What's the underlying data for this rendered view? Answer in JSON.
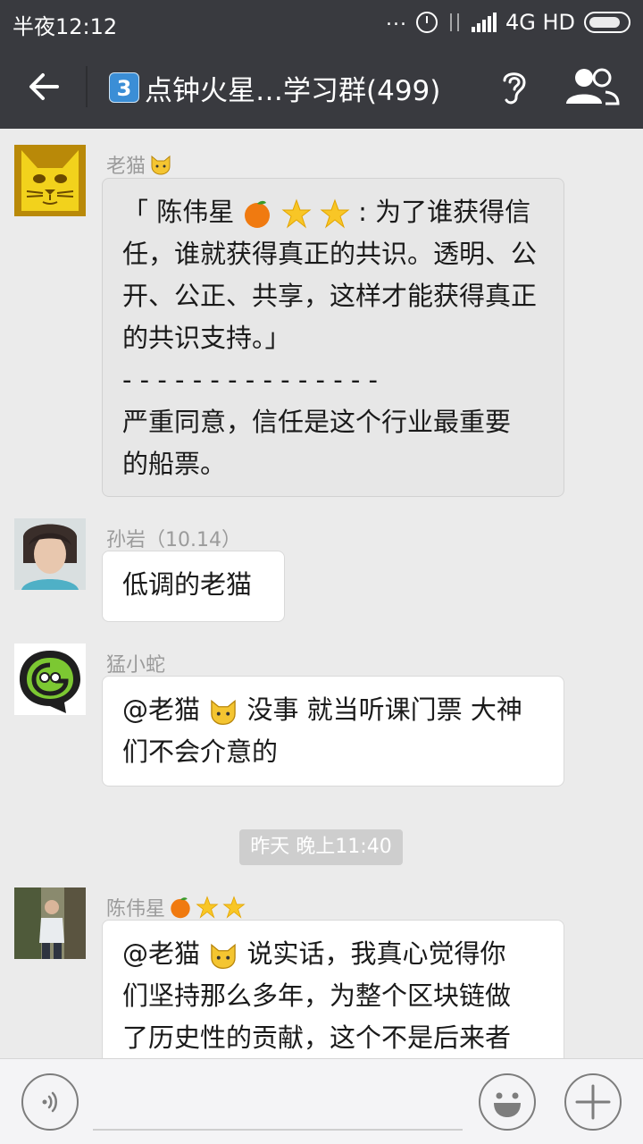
{
  "status_bar": {
    "time": "半夜12:12",
    "dots": "...",
    "network": "4G HD",
    "icons": [
      "alarm-icon",
      "data-transfer-icon",
      "signal-icon",
      "battery-icon"
    ]
  },
  "header": {
    "number_badge": "3",
    "title": "点钟火星…学习群(499)",
    "icons": [
      "back-arrow-icon",
      "ear-icon",
      "group-members-icon"
    ]
  },
  "messages": [
    {
      "sender": "老猫",
      "sender_emoji": "cat-face",
      "lines": [
        "「 陈伟星",
        "任，谁就获得真正的共识。透明、公",
        "开、公正、共享，这样才能获得真正",
        "的共识支持。」",
        "- - - - - - - - - - - - - - -",
        "严重同意，信任是这个行业最重要",
        "的船票。"
      ],
      "quote_tail": ": 为了谁获得信"
    },
    {
      "sender": "孙岩（10.14）",
      "lines": [
        "低调的老猫"
      ]
    },
    {
      "sender": "猛小蛇",
      "lines_part": {
        "at": "@老猫",
        "line1_rest": " 没事 就当听课门票 大神",
        "line2": "们不会介意的"
      }
    },
    {
      "sender": "陈伟星",
      "lines_part": {
        "at": "@老猫",
        "line1_rest": " 说实话，我真心觉得你",
        "line2": "们坚持那么多年，为整个区块链做",
        "line3": "了历史性的贡献，这个不是后来者"
      }
    }
  ],
  "timestamp": "昨天 晚上11:40",
  "input_bar": {
    "placeholder": "",
    "icons": [
      "voice-icon",
      "emoji-icon",
      "plus-icon"
    ]
  },
  "colors": {
    "bar": "#393a3f",
    "chat_bg": "#ebebeb",
    "bubble": "#ffffff",
    "quoted_bubble": "#e7e7e7",
    "name": "#9b9b9b"
  }
}
